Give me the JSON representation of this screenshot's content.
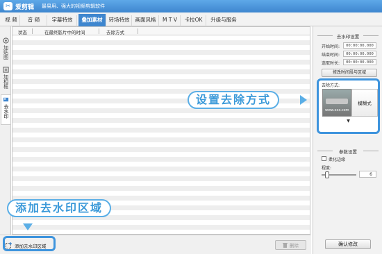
{
  "app": {
    "name": "爱剪辑",
    "tagline": "最易用、强大的视频剪辑软件",
    "logo_glyph": "✂"
  },
  "tabs": [
    {
      "label": "视  频"
    },
    {
      "label": "音  频"
    },
    {
      "label": "字幕特效"
    },
    {
      "label": "叠加素材",
      "active": true
    },
    {
      "label": "转场特效"
    },
    {
      "label": "画面风格"
    },
    {
      "label": "M T V"
    },
    {
      "label": "卡拉OK"
    },
    {
      "label": "升级与服务"
    }
  ],
  "side_tabs": [
    {
      "label": "加贴图"
    },
    {
      "label": "加相框"
    },
    {
      "label": "去水印",
      "active": true
    }
  ],
  "list": {
    "columns": [
      "状态",
      "在最终影片中的时间",
      "去除方式"
    ]
  },
  "bottom": {
    "add_label": "添加去水印区域",
    "delete_label": "删除"
  },
  "panel": {
    "section1": "去水印设置",
    "start_label": "开始时间:",
    "start_value": "00:00:00.000",
    "end_label": "结束时间:",
    "end_value": "00:00:00.000",
    "dur_label": "选取时长:",
    "dur_value": "00:00:00.000",
    "modify_btn": "修改时间段与区域",
    "mode_label": "去除方式:",
    "mode_url": "www.xxx.com",
    "mode_value": "模糊式",
    "section2": "参数设置",
    "soften_label": "柔化边缘",
    "degree_label": "程度:",
    "degree_value": "6",
    "confirm_btn": "确认修改"
  },
  "callouts": {
    "mode": "设置去除方式",
    "add": "添加去水印区域"
  },
  "colors": {
    "accent": "#3e86cf",
    "callout": "#5aaee6"
  }
}
